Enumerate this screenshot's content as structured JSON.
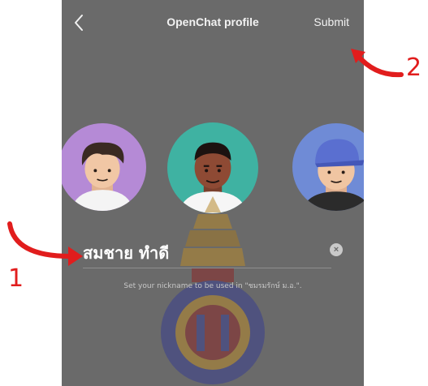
{
  "header": {
    "back_icon": "chevron-left-icon",
    "title": "OpenChat profile",
    "submit_label": "Submit"
  },
  "profile": {
    "nickname": "สมชาย ทำดี",
    "clear_icon": "clear-x-icon",
    "clear_glyph": "×",
    "hint": "Set your nickname to be used in \"ชมรมรักษ์ ม.อ.\"."
  },
  "annotations": {
    "label_1": "1",
    "label_2": "2",
    "color": "#e11d1d"
  },
  "colors": {
    "overlay": "#6a6a6a",
    "avatar_left": "#b58ad6",
    "avatar_center": "#3fb2a2",
    "avatar_right": "#6f8bd6"
  }
}
